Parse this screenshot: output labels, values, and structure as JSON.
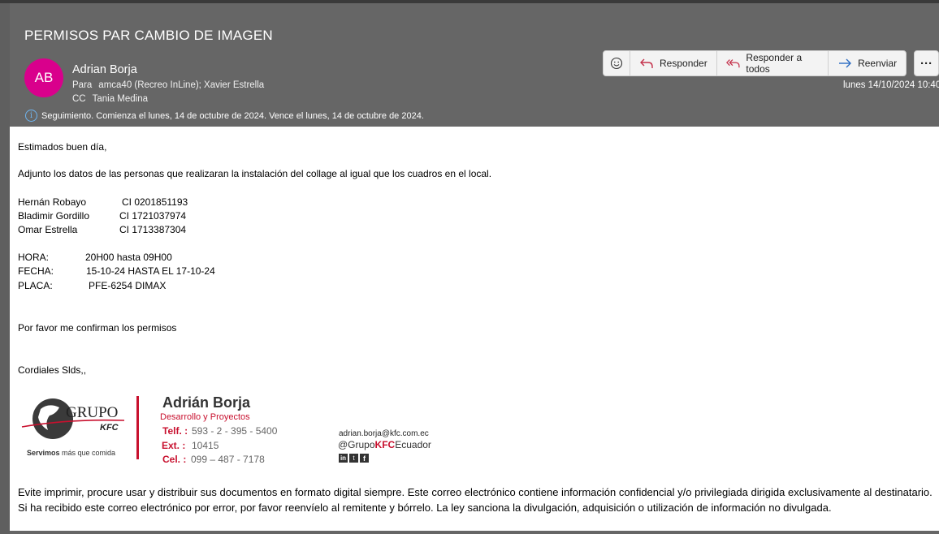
{
  "email": {
    "subject": "PERMISOS PAR CAMBIO DE IMAGEN",
    "avatar_initials": "AB",
    "sender": "Adrian Borja",
    "to_label": "Para",
    "to_value": "amca40 (Recreo InLine); Xavier Estrella",
    "cc_label": "CC",
    "cc_value": "Tania Medina",
    "followup": "Seguimiento.  Comienza el lunes, 14 de octubre de 2024.  Vence el lunes, 14 de octubre de 2024.",
    "date": "lunes 14/10/2024 10:40"
  },
  "toolbar": {
    "emoji_icon": "smiley-icon",
    "reply_label": "Responder",
    "reply_all_label": "Responder a todos",
    "forward_label": "Reenviar",
    "more_label": "···"
  },
  "body": {
    "greeting": "Estimados buen día,",
    "intro": "Adjunto los datos de las personas que realizaran la instalación del collage al igual que los cuadros en el local.",
    "people": [
      {
        "name": "Hernán Robayo",
        "ci": "CI  0201851193"
      },
      {
        "name": "Bladimir Gordillo",
        "ci": "CI 1721037974"
      },
      {
        "name": "Omar Estrella",
        "ci": "CI 1713387304"
      }
    ],
    "hora_label": "HORA:",
    "hora_value": "20H00 hasta  09H00",
    "fecha_label": "FECHA:",
    "fecha_value": "15-10-24 HASTA EL 17-10-24",
    "placa_label": "PLACA:",
    "placa_value": "PFE-6254 DIMAX",
    "request": "Por favor me confirman los permisos",
    "closing": "Cordiales Slds,,"
  },
  "signature": {
    "logo_text": "GRUPO",
    "logo_sub": "KFC",
    "tagline_bold": "Servimos",
    "tagline_rest": " más que comida",
    "name": "Adrián Borja",
    "role": "Desarrollo y Proyectos",
    "telf_label": "Telf. :",
    "telf_value": "593 - 2 - 395 - 5400",
    "ext_label": "Ext. :",
    "ext_value": "10415",
    "cel_label": "Cel. :",
    "cel_value": "099 – 487 - 7178",
    "email": "adrian.borja@kfc.com.ec",
    "handle_pre": "@Grupo",
    "handle_kfc": "KFC",
    "handle_post": "Ecuador",
    "social_icons": [
      "linkedin-icon",
      "twitter-icon",
      "facebook-icon"
    ],
    "accent_color": "#c8102e"
  },
  "disclaimer": "Evite imprimir, procure usar y distribuir sus documentos en formato digital siempre. Este correo electrónico contiene información confidencial y/o privilegiada dirigida exclusivamente al destinatario. Si ha recibido este correo electrónico por error, por favor reenvíelo al remitente y bórrelo. La ley sanciona la divulgación, adquisición o utilización de información no divulgada."
}
